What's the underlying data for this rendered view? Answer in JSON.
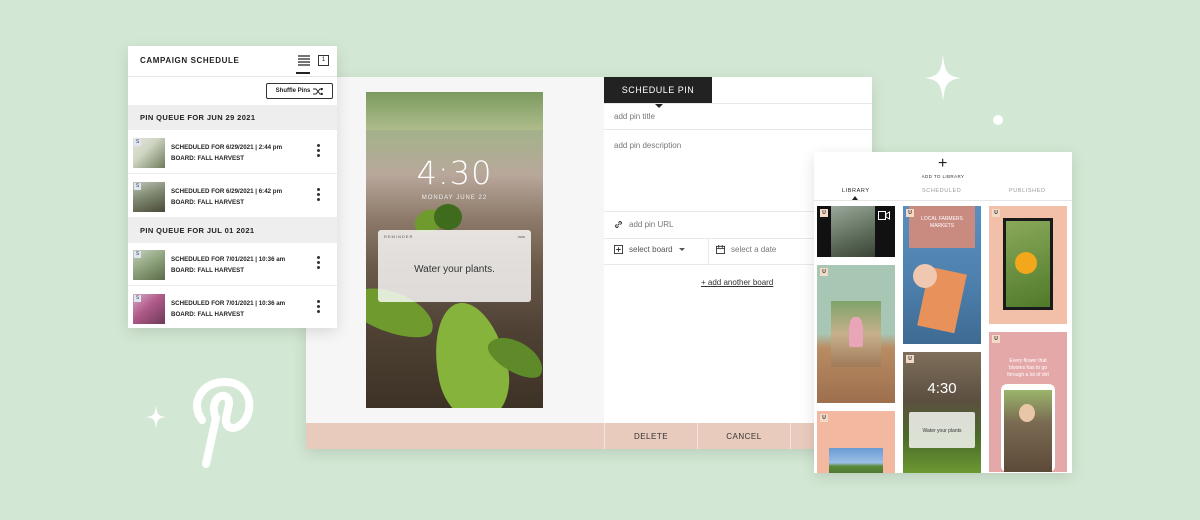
{
  "schedule": {
    "title": "CAMPAIGN SCHEDULE",
    "calendar_day": "1",
    "shuffle_label": "Shuffle Pins",
    "queues": [
      {
        "heading": "PIN QUEUE FOR JUN 29 2021",
        "pins": [
          {
            "tag": "S",
            "line1": "SCHEDULED FOR 6/29/2021 | 2:44 pm",
            "line2": "BOARD: FALL HARVEST"
          },
          {
            "tag": "S",
            "line1": "SCHEDULED FOR 6/29/2021 | 6:42 pm",
            "line2": "BOARD: FALL HARVEST"
          }
        ]
      },
      {
        "heading": "PIN QUEUE FOR JUL 01 2021",
        "pins": [
          {
            "tag": "S",
            "line1": "SCHEDULED FOR 7/01/2021 | 10:36 am",
            "line2": "BOARD: FALL HARVEST"
          },
          {
            "tag": "S",
            "line1": "SCHEDULED FOR 7/01/2021 | 10:36 am",
            "line2": "BOARD: FALL HARVEST"
          }
        ]
      }
    ]
  },
  "editor": {
    "phone_time": "4:30",
    "phone_date": "MONDAY JUNE 22",
    "reminder_label": "REMINDER",
    "reminder_now": "now",
    "reminder_text": "Water your plants.",
    "tab_label": "SCHEDULE PIN",
    "title_placeholder": "add pin title",
    "description_placeholder": "add pin description",
    "url_placeholder": "add pin URL",
    "board_select": "select board",
    "date_placeholder": "select a date",
    "add_board_link": "+ add another board",
    "delete_label": "DELETE",
    "cancel_label": "CANCEL"
  },
  "library": {
    "add_label": "ADD TO LIBRARY",
    "tabs": [
      "LIBRARY",
      "SCHEDULED",
      "PUBLISHED"
    ],
    "active_tab": "LIBRARY",
    "tile_badge": "U",
    "tile_farmers": "LOCAL FARMERS MARKETS",
    "tile_time": "4:30",
    "tile_water": "Water your plants",
    "tile_flower_text": "Every flower that blooms has to go through a lot of dirt"
  },
  "colors": {
    "background": "#d3e8d4",
    "footer": "#e8cbbc",
    "dark": "#222222"
  }
}
